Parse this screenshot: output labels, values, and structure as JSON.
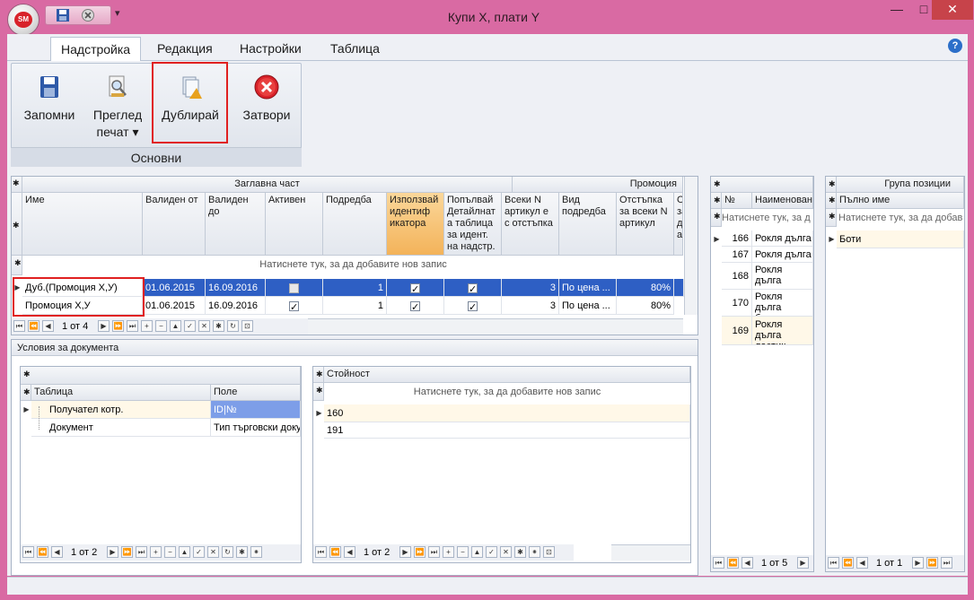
{
  "window": {
    "title": "Купи X, плати Y",
    "app_badge": "SM",
    "min_glyph": "—",
    "max_glyph": "□",
    "close_glyph": "✕",
    "qat_more_glyph": "▾"
  },
  "ribbon": {
    "tabs": [
      "Надстройка",
      "Редакция",
      "Настройки",
      "Таблица"
    ],
    "active_tab": 0,
    "group_label": "Основни",
    "buttons": {
      "save": "Запомни",
      "preview_line1": "Преглед",
      "preview_line2": "печат ▾",
      "duplicate": "Дублирай",
      "close": "Затвори"
    },
    "help_glyph": "?"
  },
  "header_grid": {
    "band_main": "Заглавна част",
    "band_promo": "Промоция",
    "columns": [
      "Име",
      "Валиден от",
      "Валиден до",
      "Активен",
      "Подредба",
      "Използвай идентиф икатора",
      "Попълвай Детайлнат а таблица за идент. на надстр.",
      "Всеки N артикул е с отстъпка",
      "Вид подредба",
      "Отстъпка за всеки N артикул",
      "О за д ар"
    ],
    "new_row_hint": "Натиснете тук, за да добавите нов запис",
    "rows": [
      {
        "name": "Дуб.(Промоция X,У)",
        "from": "01.06.2015",
        "to": "16.09.2016",
        "active": false,
        "order": "1",
        "use_id": true,
        "fill": true,
        "every_n": "3",
        "sort": "По цена ...",
        "discount": "80%"
      },
      {
        "name": "Промоция X,У",
        "from": "01.06.2015",
        "to": "16.09.2016",
        "active": true,
        "order": "1",
        "use_id": true,
        "fill": true,
        "every_n": "3",
        "sort": "По цена ...",
        "discount": "80%"
      }
    ],
    "pager": "1 от 4"
  },
  "conditions": {
    "caption": "Условия за документа",
    "columns": [
      "Таблица",
      "Поле"
    ],
    "rows": [
      {
        "table": "Получател котр.",
        "field": "ID|№"
      },
      {
        "table": "Документ",
        "field": "Тип търговски доку"
      }
    ],
    "pager": "1 от 2"
  },
  "values": {
    "column": "Стойност",
    "new_row_hint": "Натиснете тук, за да добавите нов запис",
    "rows": [
      "160",
      "191"
    ],
    "pager": "1 от 2"
  },
  "items": {
    "columns": [
      "№",
      "Наименовани"
    ],
    "filter_hint": "Натиснете тук, за д",
    "rows": [
      {
        "no": "166",
        "name": "Рокля дълга"
      },
      {
        "no": "167",
        "name": "Рокля дълга"
      },
      {
        "no": "168",
        "name": "Рокля дълга прихлупване"
      },
      {
        "no": "170",
        "name": "Рокля дълга бродерия"
      },
      {
        "no": "169",
        "name": "Рокля дълга ластик ТЕСТ"
      }
    ],
    "pager": "1 от 5"
  },
  "groups": {
    "caption": "Група позиции",
    "column": "Пълно име",
    "filter_hint": "Натиснете тук, за да добав",
    "rows": [
      "Боти"
    ],
    "pager": "1 от 1"
  }
}
